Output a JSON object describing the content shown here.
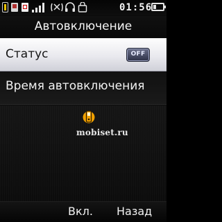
{
  "status_bar": {
    "time": "01:56",
    "icons": [
      "phone-battery-icon",
      "sim-icon",
      "message-icon",
      "signal-icon",
      "vibrate-icon",
      "headset-icon",
      "bag-icon",
      "battery-icon"
    ]
  },
  "title": "Автовключение",
  "list": {
    "items": [
      {
        "label": "Статус",
        "selected": true,
        "toggle": {
          "label": "OFF",
          "state": false
        }
      },
      {
        "label": "Время автовключения",
        "selected": false
      }
    ]
  },
  "watermark": {
    "text": "mobiset.ru",
    "icon": "mobile-phone-icon"
  },
  "softkeys": {
    "left": "Вкл.",
    "right": "Назад"
  },
  "colors": {
    "selection": "#e9e9ee",
    "toggle_off": "#3a3f58",
    "watermark_accent": "#f0a000"
  }
}
